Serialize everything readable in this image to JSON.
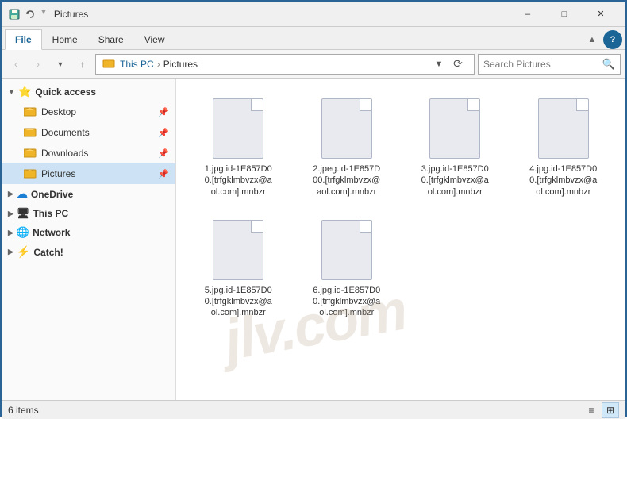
{
  "titleBar": {
    "title": "Pictures",
    "controls": {
      "minimize": "–",
      "maximize": "□",
      "close": "✕"
    }
  },
  "ribbon": {
    "tabs": [
      "File",
      "Home",
      "Share",
      "View"
    ],
    "activeTab": "File"
  },
  "addressBar": {
    "back": "‹",
    "forward": "›",
    "up": "↑",
    "pathParts": [
      "This PC",
      "Pictures"
    ],
    "searchPlaceholder": "Search Pictures",
    "refreshIcon": "⟳"
  },
  "sidebar": {
    "sections": [
      {
        "id": "quick-access",
        "label": "Quick access",
        "icon": "⭐",
        "items": [
          {
            "label": "Desktop",
            "icon": "🖥",
            "pinned": true
          },
          {
            "label": "Documents",
            "icon": "📁",
            "pinned": true
          },
          {
            "label": "Downloads",
            "icon": "📁",
            "pinned": true
          },
          {
            "label": "Pictures",
            "icon": "📁",
            "active": true,
            "pinned": true
          }
        ]
      },
      {
        "id": "onedrive",
        "label": "OneDrive",
        "icon": "☁",
        "items": []
      },
      {
        "id": "this-pc",
        "label": "This PC",
        "icon": "💻",
        "items": []
      },
      {
        "id": "network",
        "label": "Network",
        "icon": "🌐",
        "items": []
      },
      {
        "id": "catch",
        "label": "Catch!",
        "icon": "⚡",
        "items": []
      }
    ]
  },
  "files": [
    {
      "id": "file1",
      "name": "1.jpg.id-1E857D0\n0.[trfgklmbvzx@a\nol.com].mnbzr"
    },
    {
      "id": "file2",
      "name": "2.jpeg.id-1E857D\n00.[trfgklmbvzx@\naol.com].mnbzr"
    },
    {
      "id": "file3",
      "name": "3.jpg.id-1E857D0\n0.[trfgklmbvzx@a\nol.com].mnbzr"
    },
    {
      "id": "file4",
      "name": "4.jpg.id-1E857D0\n0.[trfgklmbvzx@a\nol.com].mnbzr"
    },
    {
      "id": "file5",
      "name": "5.jpg.id-1E857D0\n0.[trfgklmbvzx@a\nol.com].mnbzr"
    },
    {
      "id": "file6",
      "name": "6.jpg.id-1E857D0\n0.[trfgklmbvzx@a\nol.com].mnbzr"
    }
  ],
  "statusBar": {
    "itemCount": "6 items",
    "viewIcons": [
      "≡",
      "⊞"
    ]
  },
  "watermark": {
    "text": "jlv.com"
  }
}
